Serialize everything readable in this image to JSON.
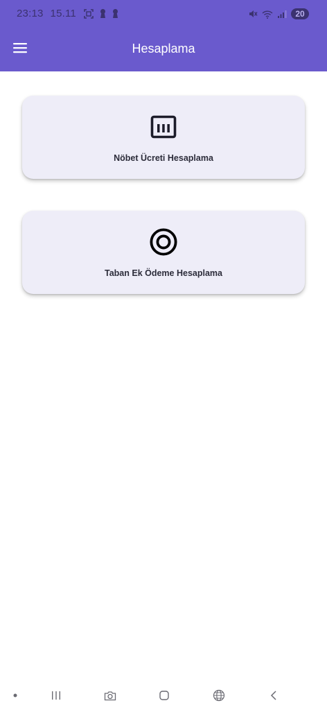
{
  "status_bar": {
    "time": "23:13",
    "date": "15.11",
    "battery": "20"
  },
  "app_bar": {
    "title": "Hesaplama",
    "menu_icon": "hamburger-menu-icon",
    "color": "#6a5acd"
  },
  "cards": [
    {
      "label": "Nöbet Ücreti Hesaplama",
      "icon": "bar-chart-box-icon"
    },
    {
      "label": "Taban Ek Ödeme Hesaplama",
      "icon": "radio-target-icon"
    }
  ],
  "nav_bar": {
    "items": [
      "dot-icon",
      "recent-apps-icon",
      "camera-icon",
      "home-icon",
      "globe-icon",
      "back-icon"
    ]
  }
}
